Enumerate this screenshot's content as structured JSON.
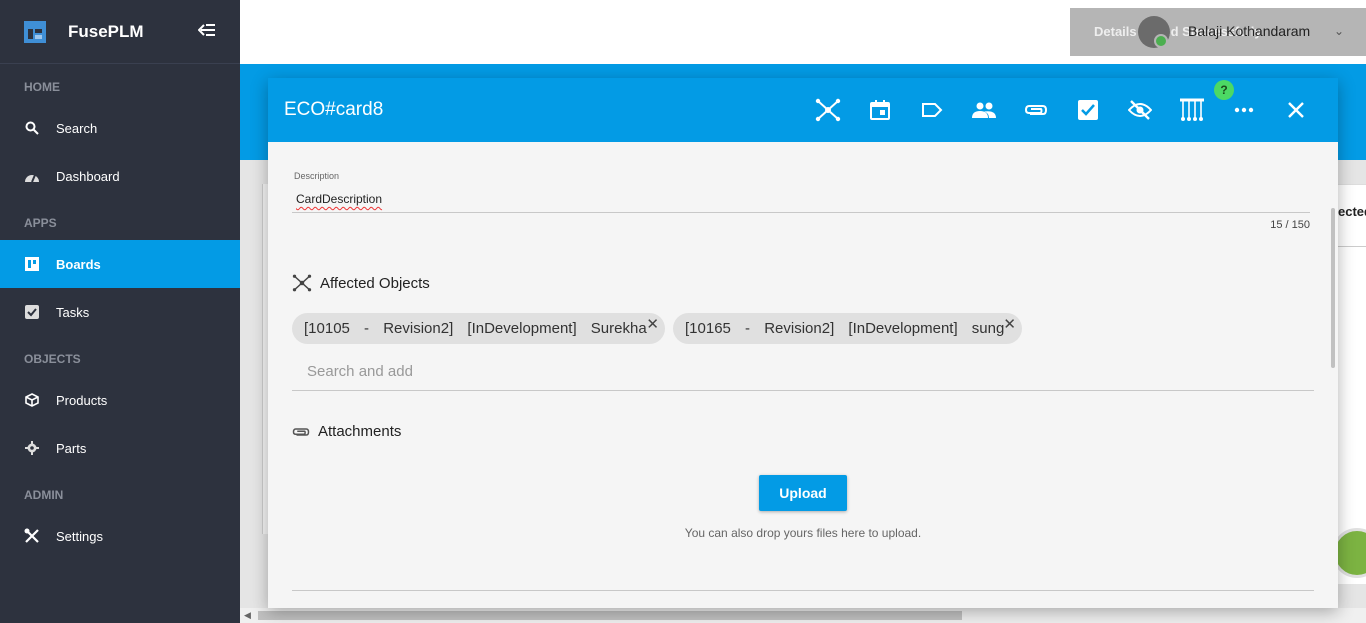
{
  "app": {
    "name": "FusePLM"
  },
  "sidebar": {
    "sections": [
      {
        "title": "HOME",
        "items": [
          {
            "label": "Search",
            "icon": "search-icon"
          },
          {
            "label": "Dashboard",
            "icon": "dashboard-icon"
          }
        ]
      },
      {
        "title": "APPS",
        "items": [
          {
            "label": "Boards",
            "icon": "boards-icon",
            "active": true
          },
          {
            "label": "Tasks",
            "icon": "tasks-icon"
          }
        ]
      },
      {
        "title": "OBJECTS",
        "items": [
          {
            "label": "Products",
            "icon": "cube-icon"
          },
          {
            "label": "Parts",
            "icon": "gear-icon"
          }
        ]
      },
      {
        "title": "ADMIN",
        "items": [
          {
            "label": "Settings",
            "icon": "tools-icon"
          }
        ]
      }
    ]
  },
  "topbar": {
    "toast": "Details Saved Successfully",
    "user_name": "Balaji Kothandaram"
  },
  "background": {
    "card_text": "ected"
  },
  "dialog": {
    "title": "ECO#card8",
    "toolbar_icons": [
      "network-icon",
      "calendar-icon",
      "label-icon",
      "people-icon",
      "attachment-icon",
      "checkbox-icon",
      "hide-icon",
      "abacus-icon",
      "more-icon",
      "close-icon"
    ],
    "help_badge": "?",
    "description": {
      "label": "Description",
      "value": "CardDescription",
      "counter": "15 / 150"
    },
    "affected_objects": {
      "title": "Affected Objects",
      "chips": [
        {
          "text": "[10105 - Revision2] [InDevelopment] Surekha"
        },
        {
          "text": "[10165 - Revision2] [InDevelopment] sung"
        }
      ],
      "search_placeholder": "Search and add"
    },
    "attachments": {
      "title": "Attachments",
      "upload_label": "Upload",
      "drop_hint": "You can also drop yours files here to upload."
    }
  },
  "colors": {
    "accent": "#039be5",
    "sidebar": "#2d323e",
    "help": "#4cd964"
  }
}
